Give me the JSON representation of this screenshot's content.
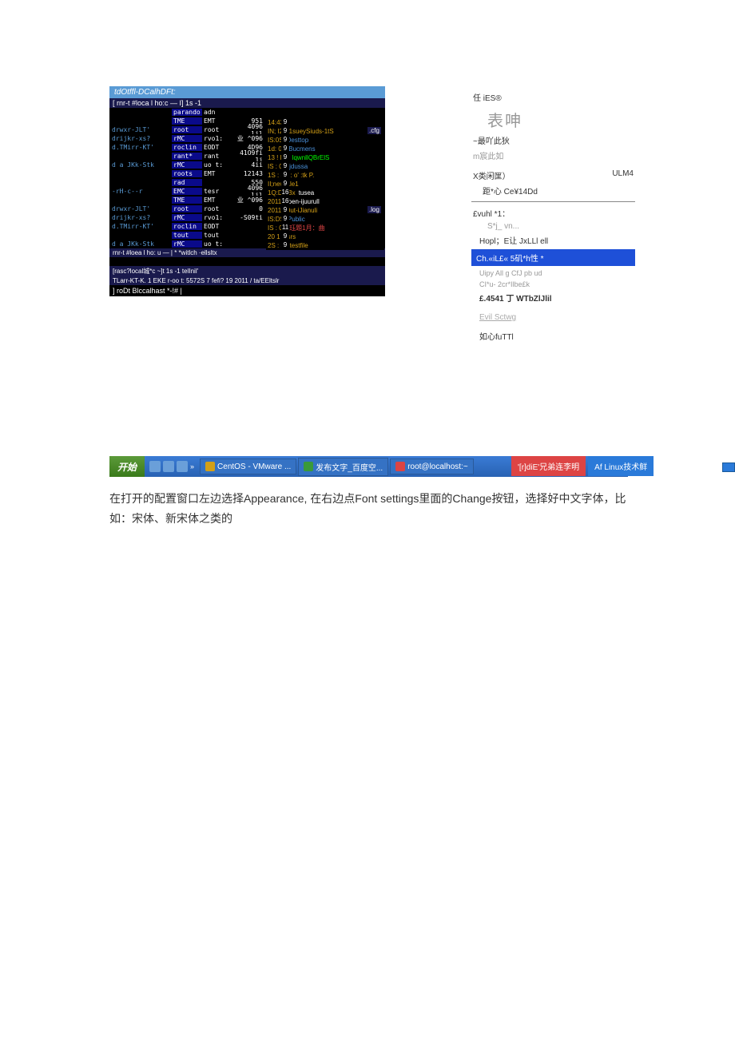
{
  "window": {
    "title": "tdOtffl-DCalhDFt:",
    "cmd_line": "[ rnr-t #loca l ho:c — I] 1s -1"
  },
  "headers": {
    "c1": "parando",
    "c2": "adn"
  },
  "rows": [
    {
      "perm": "",
      "u1": "TME",
      "u2": "EMT",
      "size": "951"
    },
    {
      "perm": "drwxr-JLT'",
      "u1": "root",
      "u2": "root",
      "size": "4096 lil"
    },
    {
      "perm": "drijkr-xs?",
      "u1": "rMC",
      "u2": "rvo1:",
      "size": "业 ^096"
    },
    {
      "perm": "d.TMirr-KT'",
      "u1": "roclin",
      "u2": "EODT",
      "size": "4D96"
    },
    {
      "perm": "",
      "u1": "rant*",
      "u2": "rant",
      "size": "41O9fi 1j"
    },
    {
      "perm": "d a JKk-Stk",
      "u1": "rMC",
      "u2": "uo t:",
      "size": "4ii"
    },
    {
      "perm": "",
      "u1": "roots",
      "u2": "EMT",
      "size": "12143"
    },
    {
      "perm": "",
      "u1": "rad",
      "u2": "",
      "size": "550"
    },
    {
      "perm": "-rH-c--r",
      "u1": "EMC",
      "u2": "tesr",
      "size": "4096 lil"
    },
    {
      "perm": "",
      "u1": "TME",
      "u2": "EMT",
      "size": "业 ^096"
    },
    {
      "perm": "drwxr-JLT'",
      "u1": "root",
      "u2": "root",
      "size": "0"
    },
    {
      "perm": "drijkr-xs?",
      "u1": "rMC",
      "u2": "rvo1:",
      "size": "-S09ti"
    },
    {
      "perm": "d.TMirr-KT'",
      "u1": "roclin",
      "u2": "EODT",
      "size": ""
    },
    {
      "perm": "",
      "u1": "tout",
      "u2": "tout",
      "size": ""
    },
    {
      "perm": "d a JKk-Stk",
      "u1": "rMC",
      "u2": "uo t:",
      "size": ""
    }
  ],
  "right_rows": [
    {
      "time": "14:43 a",
      "name": "",
      "cls": "white"
    },
    {
      "time": "IN; I2 B1sueySiuds-1tS",
      "name": "",
      "cls": "white"
    },
    {
      "time": "IS:0S",
      "name": "Desttop",
      "cls": "name-cell"
    },
    {
      "time": "1d: 06",
      "name": "Bucmens",
      "cls": "name-cell"
    },
    {
      "time": "13 ! DS",
      "name": "lqwnllQBrElS",
      "cls": "green"
    },
    {
      "time": "IS : 05",
      "name": "jdussa",
      "cls": "name-cell"
    },
    {
      "time": "1S : 3E : o' :tk P.",
      "name": "",
      "cls": "white"
    },
    {
      "time": "II;newf1le1",
      "name": "",
      "cls": "white"
    },
    {
      "time": "1Q:D5 Bx",
      "name": "tusea",
      "cls": "white"
    },
    {
      "time": "2011",
      "name": "poen-ijuurull",
      "cls": "white"
    },
    {
      "time": "2011 p0ut-iJianuli",
      "name": "",
      "cls": "white"
    },
    {
      "time": "IS:DS",
      "name": "Public",
      "cls": "name-cell"
    },
    {
      "time": "IS : 05",
      "name": "珏題1月：曲",
      "cls": "red"
    },
    {
      "time": "20 1 8  srs",
      "name": "",
      "cls": "white"
    },
    {
      "time": "2S : 35 testfile",
      "name": "",
      "cls": "white"
    }
  ],
  "nums": [
    "9",
    "9",
    "9",
    "9",
    "9",
    "9",
    "9",
    "9",
    "16",
    "16",
    "9",
    "9",
    "11",
    "9",
    "9"
  ],
  "cfg": ".cfg",
  "log": ".log",
  "bottom1": "rnr-t #loea l ho: u — | * *witlch ·ellsltx",
  "bottom2": "[rasc?local城*c ~]t 1s -1                           telInil'",
  "bottom3": "TLarr-KT-K. 1 EKE r-oo t: 5572S 7 fefi? 19 2011 / ta/EEltslr",
  "prompt": "] roDt Blccalhast *-!# |",
  "sidebar": {
    "s1": "任 iES®",
    "s2": "表呻",
    "s3": "~最吖此狄",
    "s4": "m宸此如",
    "s5": "X类闲匩）",
    "s5r": "ULM4",
    "s6": "距*心 Ce¥14Dd",
    "s7": "£vuhl *1：",
    "s8": "S*j_ vn...",
    "s9": "Hopl；E让 JxLLl ell",
    "s10": "Ch.«iL£« 5矶*h性 *",
    "s11": "Uipy All g CfJ pb ud",
    "s12": "CI*u- 2cr*Ilbe£k",
    "s13": "£.4541 丁 WTbZlJlil",
    "s14": "Evil Sctwg",
    "s15": "如心fuTTl"
  },
  "taskbar": {
    "start": "开始",
    "btn1": "CentOS - VMware ...",
    "btn2": "发布文字_百度空...",
    "btn3": "root@localhost:~",
    "t1": "'[r]diE'兄弟连李明",
    "t2": "Af Linux技术鲜"
  },
  "instruction": "在打开的配置窗口左边选择Appearance, 在右边点Font settings里面的Change按钮，选择好中文字体，比如：宋体、新宋体之类的"
}
